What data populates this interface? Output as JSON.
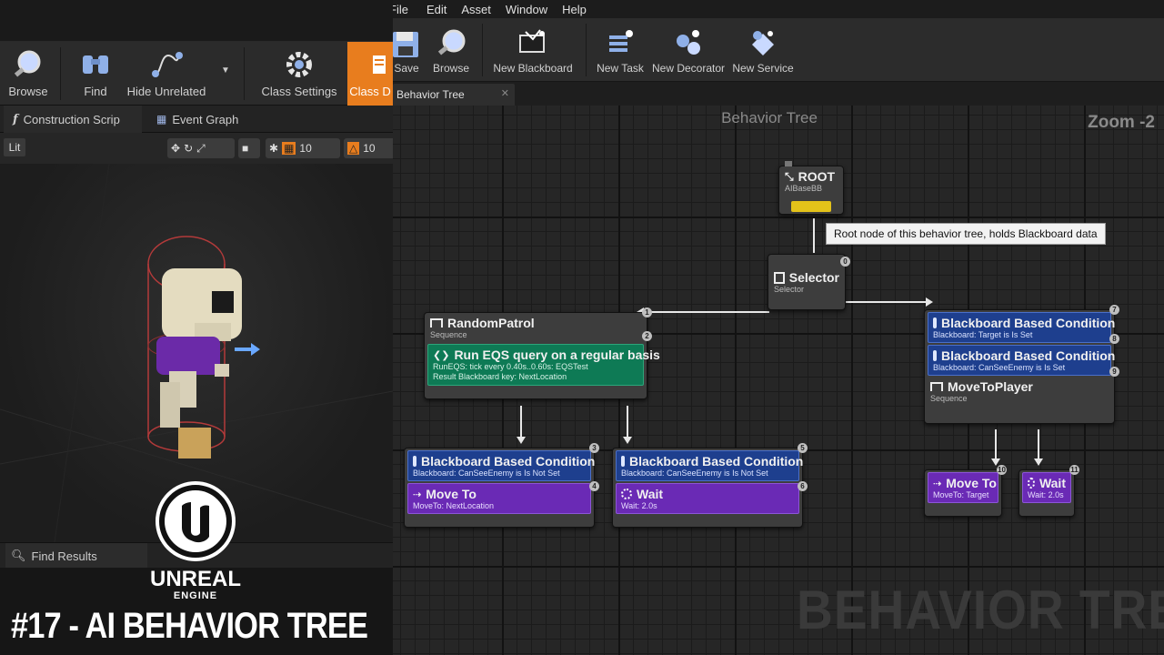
{
  "left_toolbar": {
    "browse": "Browse",
    "find": "Find",
    "hide_unrelated": "Hide Unrelated",
    "class_settings": "Class Settings",
    "class_defaults": "Class D"
  },
  "left_tabs": {
    "construction_script": "Construction Scrip",
    "event_graph": "Event Graph"
  },
  "viewport_bar": {
    "lit": "Lit",
    "grid_snap": "10",
    "rot_snap": "10"
  },
  "find_results": {
    "label": "Find Results"
  },
  "logo": {
    "word": "UNREAL",
    "sub": "ENGINE"
  },
  "video_title": "#17 - AI BEHAVIOR TREE",
  "menu": [
    "File",
    "Edit",
    "Asset",
    "Window",
    "Help"
  ],
  "right_toolbar": {
    "save": "Save",
    "browse": "Browse",
    "new_blackboard": "New Blackboard",
    "new_task": "New Task",
    "new_decorator": "New Decorator",
    "new_service": "New Service"
  },
  "doc_tab": {
    "label": "Behavior Tree"
  },
  "graph": {
    "title": "Behavior Tree",
    "zoom": "Zoom -2",
    "watermark": "BEHAVIOR TREE",
    "tooltip": "Root node of this behavior tree, holds Blackboard data",
    "nodes": {
      "root": {
        "title": "ROOT",
        "sub": "AIBaseBB"
      },
      "selector": {
        "title": "Selector",
        "sub": "Selector",
        "badge": "0"
      },
      "random_patrol": {
        "title": "RandomPatrol",
        "sub": "Sequence",
        "badge_in": "1",
        "badge_out": "2",
        "service_title": "Run EQS query on a regular basis",
        "service_line1": "RunEQS: tick every 0.40s..0.60s: EQSTest",
        "service_line2": "Result Blackboard key: NextLocation"
      },
      "move_to_player": {
        "title": "MoveToPlayer",
        "sub": "Sequence",
        "badge_top": "7",
        "badge_d1": "8",
        "badge_d2": "9",
        "deco1_title": "Blackboard Based Condition",
        "deco1_sub": "Blackboard: Target is Is Set",
        "deco2_title": "Blackboard Based Condition",
        "deco2_sub": "Blackboard: CanSeeEnemy is Is Set"
      },
      "patrol_move": {
        "deco_title": "Blackboard Based Condition",
        "deco_sub": "Blackboard: CanSeeEnemy is Is Not Set",
        "task_title": "Move To",
        "task_sub": "MoveTo: NextLocation",
        "badge_top": "3",
        "badge_task": "4"
      },
      "patrol_wait": {
        "deco_title": "Blackboard Based Condition",
        "deco_sub": "Blackboard: CanSeeEnemy is Is Not Set",
        "task_title": "Wait",
        "task_sub": "Wait: 2.0s",
        "badge_top": "5",
        "badge_task": "6"
      },
      "player_move": {
        "title": "Move To",
        "sub": "MoveTo: Target",
        "badge": "10"
      },
      "player_wait": {
        "title": "Wait",
        "sub": "Wait: 2.0s",
        "badge": "11"
      }
    }
  },
  "colors": {
    "decorator": "#1e3f8e",
    "task": "#6a2ab5",
    "service": "#0e7a55",
    "root_pin": "#e3c21a",
    "class_defaults": "#e87d1e"
  }
}
